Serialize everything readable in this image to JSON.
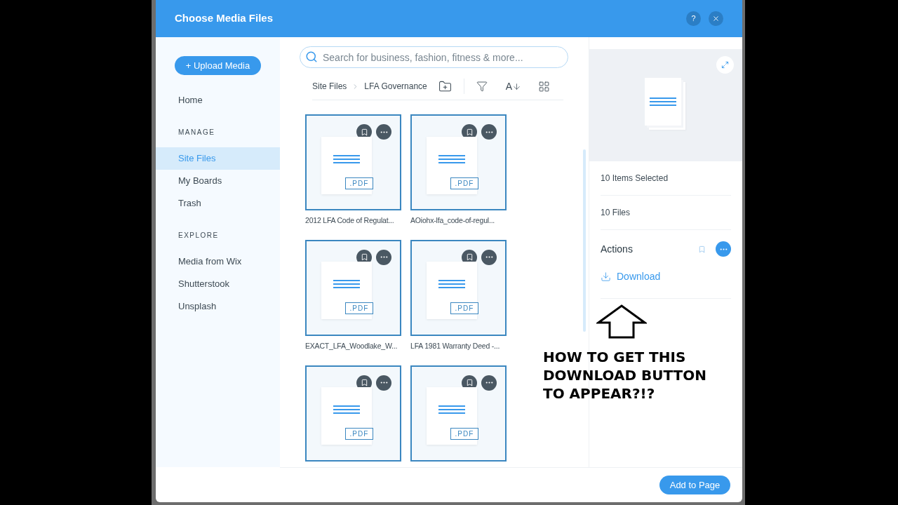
{
  "dialog": {
    "title": "Choose Media Files",
    "help": "?"
  },
  "sidebar": {
    "upload_button": "+ Upload Media",
    "items": [
      {
        "kind": "link",
        "label": "Home",
        "selected": false
      },
      {
        "kind": "heading",
        "label": "MANAGE"
      },
      {
        "kind": "link",
        "label": "Site Files",
        "selected": true
      },
      {
        "kind": "link",
        "label": "My Boards",
        "selected": false
      },
      {
        "kind": "link",
        "label": "Trash",
        "selected": false
      },
      {
        "kind": "heading",
        "label": "EXPLORE"
      },
      {
        "kind": "link",
        "label": "Media from Wix",
        "selected": false
      },
      {
        "kind": "link",
        "label": "Shutterstook",
        "selected": false
      },
      {
        "kind": "link",
        "label": "Unsplash",
        "selected": false
      }
    ]
  },
  "search": {
    "placeholder": "Search for business, fashion, fitness & more..."
  },
  "breadcrumb": [
    "Site Files",
    "LFA Governance"
  ],
  "sort_label": "A",
  "files": [
    {
      "name": "2012 LFA Code of Regulat...",
      "ext": ".PDF"
    },
    {
      "name": "AOiohx-lfa_code-of-regul...",
      "ext": ".PDF"
    },
    {
      "name": "EXACT_LFA_Woodlake_W...",
      "ext": ".PDF"
    },
    {
      "name": "LFA 1981 Warranty Deed -...",
      "ext": ".PDF"
    },
    {
      "ext": ".PDF"
    },
    {
      "ext": ".PDF"
    }
  ],
  "details": {
    "selected_count": "10 Items Selected",
    "file_count": "10 Files",
    "actions_title": "Actions",
    "download": "Download"
  },
  "annotation": {
    "text": "HOW TO GET THIS DOWNLOAD BUTTON TO APPEAR?!?"
  },
  "footer": {
    "button": "Add to Page"
  }
}
